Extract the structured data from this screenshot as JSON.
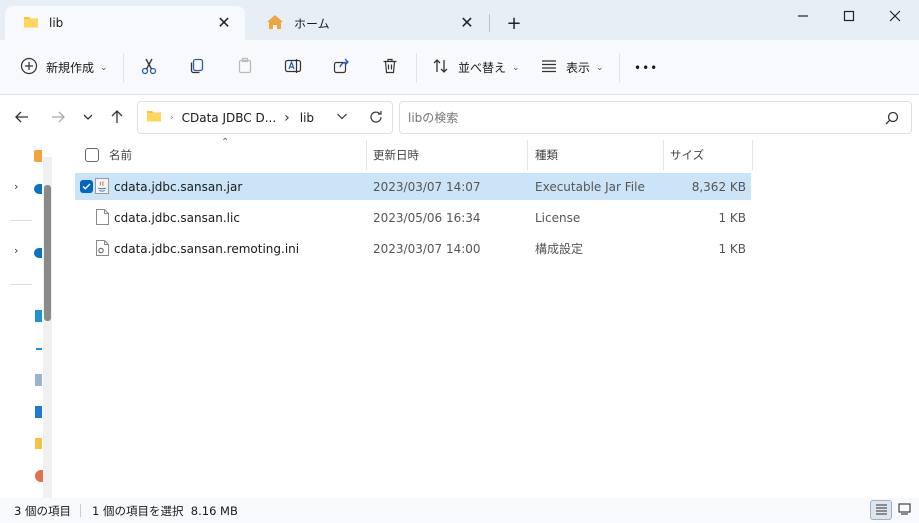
{
  "tabs": [
    {
      "label": "lib",
      "icon": "folder-icon",
      "active": true
    },
    {
      "label": "ホーム",
      "icon": "home-icon",
      "active": false
    }
  ],
  "window_controls": [
    "minimize",
    "maximize",
    "close"
  ],
  "toolbar": {
    "new_label": "新規作成",
    "sort_label": "並べ替え",
    "view_label": "表示",
    "more_label": "•••"
  },
  "address": {
    "crumbs": [
      "CData JDBC D...",
      "lib"
    ]
  },
  "search": {
    "placeholder": "libの検索"
  },
  "columns": {
    "name": "名前",
    "date": "更新日時",
    "type": "種類",
    "size": "サイズ"
  },
  "files": [
    {
      "name": "cdata.jdbc.sansan.jar",
      "date": "2023/03/07 14:07",
      "type": "Executable Jar File",
      "size": "8,362 KB",
      "icon": "java-jar-icon",
      "selected": true
    },
    {
      "name": "cdata.jdbc.sansan.lic",
      "date": "2023/05/06 16:34",
      "type": "License",
      "size": "1 KB",
      "icon": "blank-file-icon",
      "selected": false
    },
    {
      "name": "cdata.jdbc.sansan.remoting.ini",
      "date": "2023/03/07 14:00",
      "type": "構成設定",
      "size": "1 KB",
      "icon": "settings-file-icon",
      "selected": false
    }
  ],
  "status": {
    "item_count": "3 個の項目",
    "selection": "1 個の項目を選択  8.16 MB"
  },
  "colors": {
    "accent": "#0067c0",
    "selection": "#cce4f7",
    "tabbar": "#e8eef5"
  }
}
